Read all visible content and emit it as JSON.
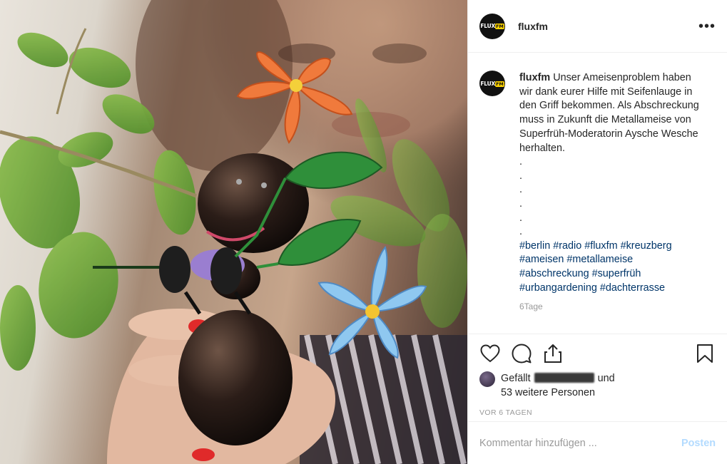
{
  "post": {
    "image_alt": "Metallameise mit Blumen vor einer Person",
    "author": {
      "username": "fluxfm",
      "avatar_icon": "fluxfm-logo-avatar",
      "logo_text": "FLUX",
      "logo_badge": "FM"
    },
    "more_icon": "more-options-icon",
    "more_label": "•••"
  },
  "caption": {
    "username": "fluxfm",
    "text": "Unser Ameisenproblem haben wir dank eurer Hilfe mit Seifenlauge in den Griff bekommen. Als Abschreckung muss in Zukunft die Metallameise von Superfrüh-Moderatorin Aysche Wesche herhalten.",
    "dots": [
      ".",
      ".",
      ".",
      ".",
      ".",
      "."
    ],
    "hashtag_lines": [
      [
        "#berlin",
        "#radio",
        "#fluxfm",
        "#kreuzberg"
      ],
      [
        "#ameisen",
        "#metallameise"
      ],
      [
        "#abschreckung",
        "#superfrüh"
      ],
      [
        "#urbangardening",
        "#dachterrasse"
      ]
    ],
    "age": "6Tage"
  },
  "actions": {
    "icons": [
      "heart-icon",
      "comment-icon",
      "share-icon",
      "bookmark-icon"
    ]
  },
  "likes": {
    "prefix": "Gefällt",
    "suffix": "und",
    "more": "53 weitere Personen"
  },
  "timestamp": "VOR 6 TAGEN",
  "comment_box": {
    "placeholder": "Kommentar hinzufügen ...",
    "post_label": "Posten"
  },
  "colors": {
    "hashtag": "#003569",
    "post_disabled": "#b3dbff",
    "muted": "#999999",
    "border": "#efefef"
  }
}
